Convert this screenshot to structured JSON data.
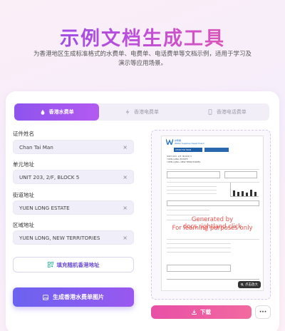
{
  "hero": {
    "title": "示例文档生成工具",
    "subtitle": "为香港地区生成标准格式的水费单、电费单、电话费单等文档示例，适用于学习及演示等应用场景。"
  },
  "tabs": [
    {
      "label": "香港水费单",
      "icon": "water-drop-icon",
      "active": true
    },
    {
      "label": "香港电费单",
      "icon": "lightning-icon",
      "active": false
    },
    {
      "label": "香港电话费单",
      "icon": "phone-icon",
      "active": false
    }
  ],
  "form": {
    "fields": [
      {
        "label": "证件姓名",
        "value": "Chan Tai Man"
      },
      {
        "label": "单元地址",
        "value": "UNIT 203, 2/F, BLOCK 5"
      },
      {
        "label": "街道地址",
        "value": "YUEN LONG ESTATE"
      },
      {
        "label": "区域地址",
        "value": "YUEN LONG, NEW TERRITORIES"
      }
    ],
    "clear_glyph": "×",
    "random_button": "填充随机香港地址",
    "generate_button": "生成香港水费单图片"
  },
  "preview": {
    "watermark_line1": "Generated by docs.rightland.click",
    "watermark_line2": "For learning purposes only",
    "zoom_label": "点击放大",
    "bill": {
      "logo_text": "水務署",
      "dept_en": "Water Supplies Department",
      "name": "CHAN TAI MAN",
      "address_lines": [
        "UNIT 203, 2/F, BLOCK 5",
        "YUEN LONG ESTATE",
        "YUEN LONG, NEW TERRITORIES"
      ],
      "stamp": "LONG"
    }
  },
  "actions": {
    "download": "下载",
    "more": "···"
  },
  "colors": {
    "accent_purple": "#8e54ee",
    "accent_pink": "#e84fa6",
    "watermark_red": "#e8362f"
  }
}
